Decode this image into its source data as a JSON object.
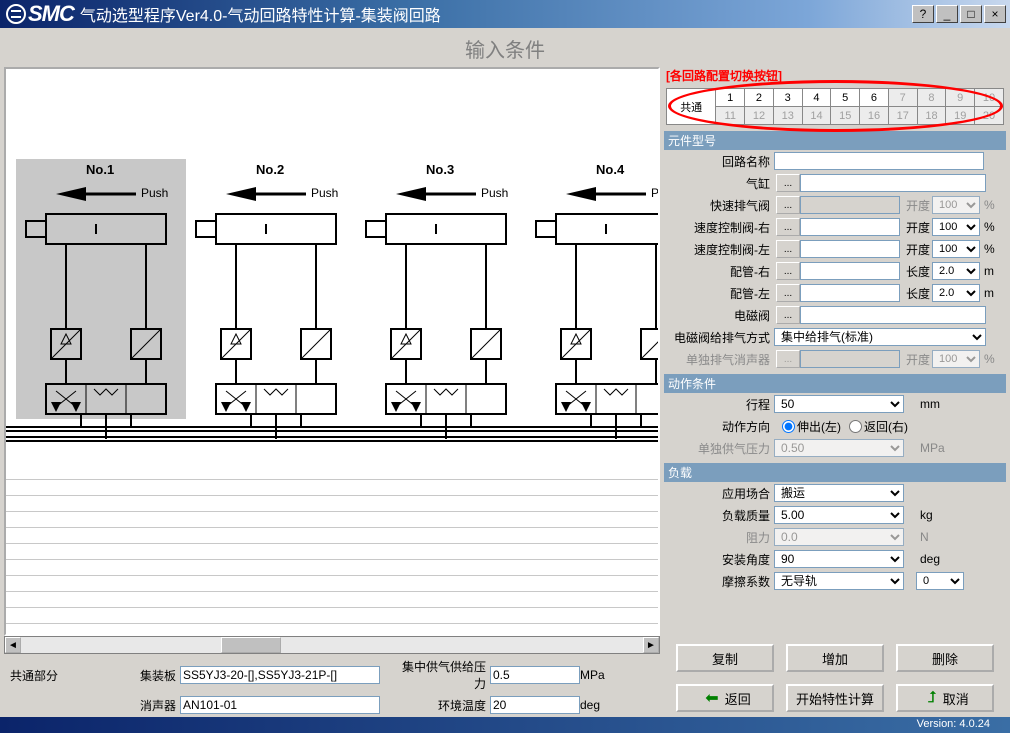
{
  "window": {
    "title": "气动选型程序Ver4.0-气动回路特性计算-集装阀回路",
    "help_icon": "?",
    "min_icon": "_",
    "max_icon": "□",
    "close_icon": "×"
  },
  "heading": "输入条件",
  "diagram": {
    "nodes": [
      {
        "label": "No.1",
        "push": "Push"
      },
      {
        "label": "No.2",
        "push": "Push"
      },
      {
        "label": "No.3",
        "push": "Push"
      },
      {
        "label": "No.4",
        "push": "Push"
      }
    ]
  },
  "common": {
    "section_label": "共通部分",
    "manifold_label": "集装板",
    "manifold_value": "SS5YJ3-20-[],SS5YJ3-21P-[]",
    "supply_press_label": "集中供气供给压力",
    "supply_press_value": "0.5",
    "supply_press_unit": "MPa",
    "silencer_label": "消声器",
    "silencer_value": "AN101-01",
    "env_temp_label": "环境温度",
    "env_temp_value": "20",
    "env_temp_unit": "deg"
  },
  "tabs": {
    "header": "[各回路配置切换按钮]",
    "common_label": "共通",
    "row1": [
      "1",
      "2",
      "3",
      "4",
      "5",
      "6",
      "7",
      "8",
      "9",
      "10"
    ],
    "row2": [
      "11",
      "12",
      "13",
      "14",
      "15",
      "16",
      "17",
      "18",
      "19",
      "20"
    ]
  },
  "sections": {
    "components": "元件型号",
    "motion": "动作条件",
    "load": "负载"
  },
  "components": {
    "circuit_name": {
      "label": "回路名称",
      "value": ""
    },
    "cylinder": {
      "label": "气缸",
      "value": ""
    },
    "quick_exhaust": {
      "label": "快速排气阀",
      "value": "",
      "extra_label": "开度",
      "extra_value": "100",
      "unit": "%"
    },
    "speed_ctrl_r": {
      "label": "速度控制阀-右",
      "value": "",
      "extra_label": "开度",
      "extra_value": "100",
      "unit": "%"
    },
    "speed_ctrl_l": {
      "label": "速度控制阀-左",
      "value": "",
      "extra_label": "开度",
      "extra_value": "100",
      "unit": "%"
    },
    "pipe_r": {
      "label": "配管-右",
      "value": "",
      "extra_label": "长度",
      "extra_value": "2.0",
      "unit": "m"
    },
    "pipe_l": {
      "label": "配管-左",
      "value": "",
      "extra_label": "长度",
      "extra_value": "2.0",
      "unit": "m"
    },
    "solenoid": {
      "label": "电磁阀",
      "value": ""
    },
    "supply_type": {
      "label": "电磁阀给排气方式",
      "value": "集中给排气(标准)"
    },
    "indiv_silencer": {
      "label": "单独排气消声器",
      "value": "",
      "extra_label": "开度",
      "extra_value": "100",
      "unit": "%"
    }
  },
  "motion": {
    "stroke": {
      "label": "行程",
      "value": "50",
      "unit": "mm"
    },
    "direction": {
      "label": "动作方向",
      "opt1": "伸出(左)",
      "opt2": "返回(右)"
    },
    "indiv_press": {
      "label": "单独供气压力",
      "value": "0.50",
      "unit": "MPa"
    }
  },
  "load": {
    "application": {
      "label": "应用场合",
      "value": "搬运"
    },
    "mass": {
      "label": "负载质量",
      "value": "5.00",
      "unit": "kg"
    },
    "resistance": {
      "label": "阻力",
      "value": "0.0",
      "unit": "N"
    },
    "angle": {
      "label": "安装角度",
      "value": "90",
      "unit": "deg"
    },
    "friction": {
      "label": "摩擦系数",
      "value": "无导轨",
      "spin": "0"
    }
  },
  "buttons": {
    "copy": "复制",
    "add": "增加",
    "delete": "删除",
    "back": "返回",
    "calc": "开始特性计算",
    "cancel": "取消"
  },
  "status": {
    "version": "Version: 4.0.24"
  }
}
